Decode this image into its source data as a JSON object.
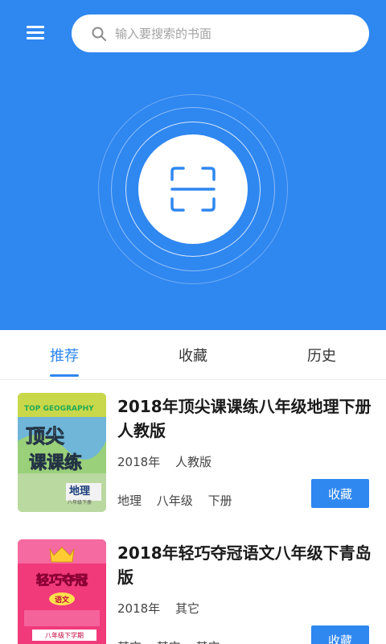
{
  "header": {
    "menu_icon": "menu-icon",
    "search": {
      "placeholder": "输入要搜索的书面",
      "icon": "search-icon"
    },
    "scan_icon": "scan-icon",
    "accent": "#2f87f0"
  },
  "tabs": [
    {
      "label": "推荐",
      "active": true
    },
    {
      "label": "收藏",
      "active": false
    },
    {
      "label": "历史",
      "active": false
    }
  ],
  "books": [
    {
      "title": "2018年顶尖课课练八年级地理下册人教版",
      "year": "2018年",
      "publisher": "人教版",
      "tags": [
        "地理",
        "八年级",
        "下册"
      ],
      "action": "收藏",
      "cover": {
        "top_text": "TOP GEOGRAPHY",
        "brand": "顶尖",
        "series": "课课练",
        "subject": "地理",
        "edition": "八年级下册"
      }
    },
    {
      "title": "2018年轻巧夺冠语文八年级下青岛版",
      "year": "2018年",
      "publisher": "其它",
      "tags": [
        "其它",
        "其它",
        "其它"
      ],
      "action": "收藏",
      "cover": {
        "brand": "轻巧夺冠",
        "subject": "语文",
        "edition": "八年级下学期"
      }
    }
  ]
}
